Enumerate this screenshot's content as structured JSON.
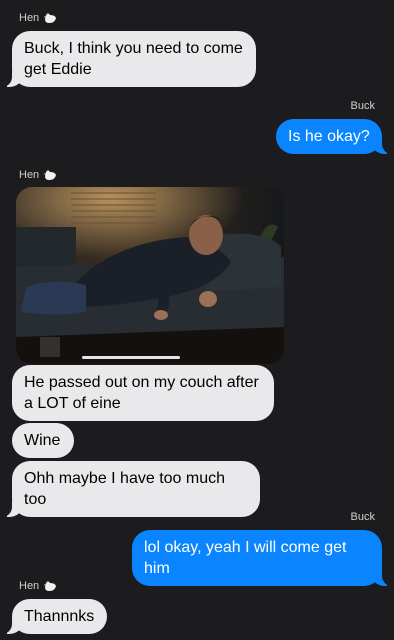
{
  "messages": [
    {
      "sender": "Hen",
      "sender_icon": "chicken-emoji",
      "text": "Buck, I think you need to come get Eddie"
    },
    {
      "sender": "Buck",
      "text": "Is he okay?"
    },
    {
      "sender": "Hen",
      "sender_icon": "chicken-emoji",
      "attachment": "photo-man-asleep-on-couch",
      "texts": [
        "He passed out on my couch after a LOT of eine",
        "Wine",
        "Ohh maybe I have too much too"
      ]
    },
    {
      "sender": "Buck",
      "text": "lol okay, yeah I will come get him"
    },
    {
      "sender": "Hen",
      "sender_icon": "chicken-emoji",
      "text": "Thannnks"
    }
  ],
  "colors": {
    "background": "#1c1c1e",
    "incoming_bubble": "#e9e9eb",
    "outgoing_bubble": "#0a84ff"
  }
}
